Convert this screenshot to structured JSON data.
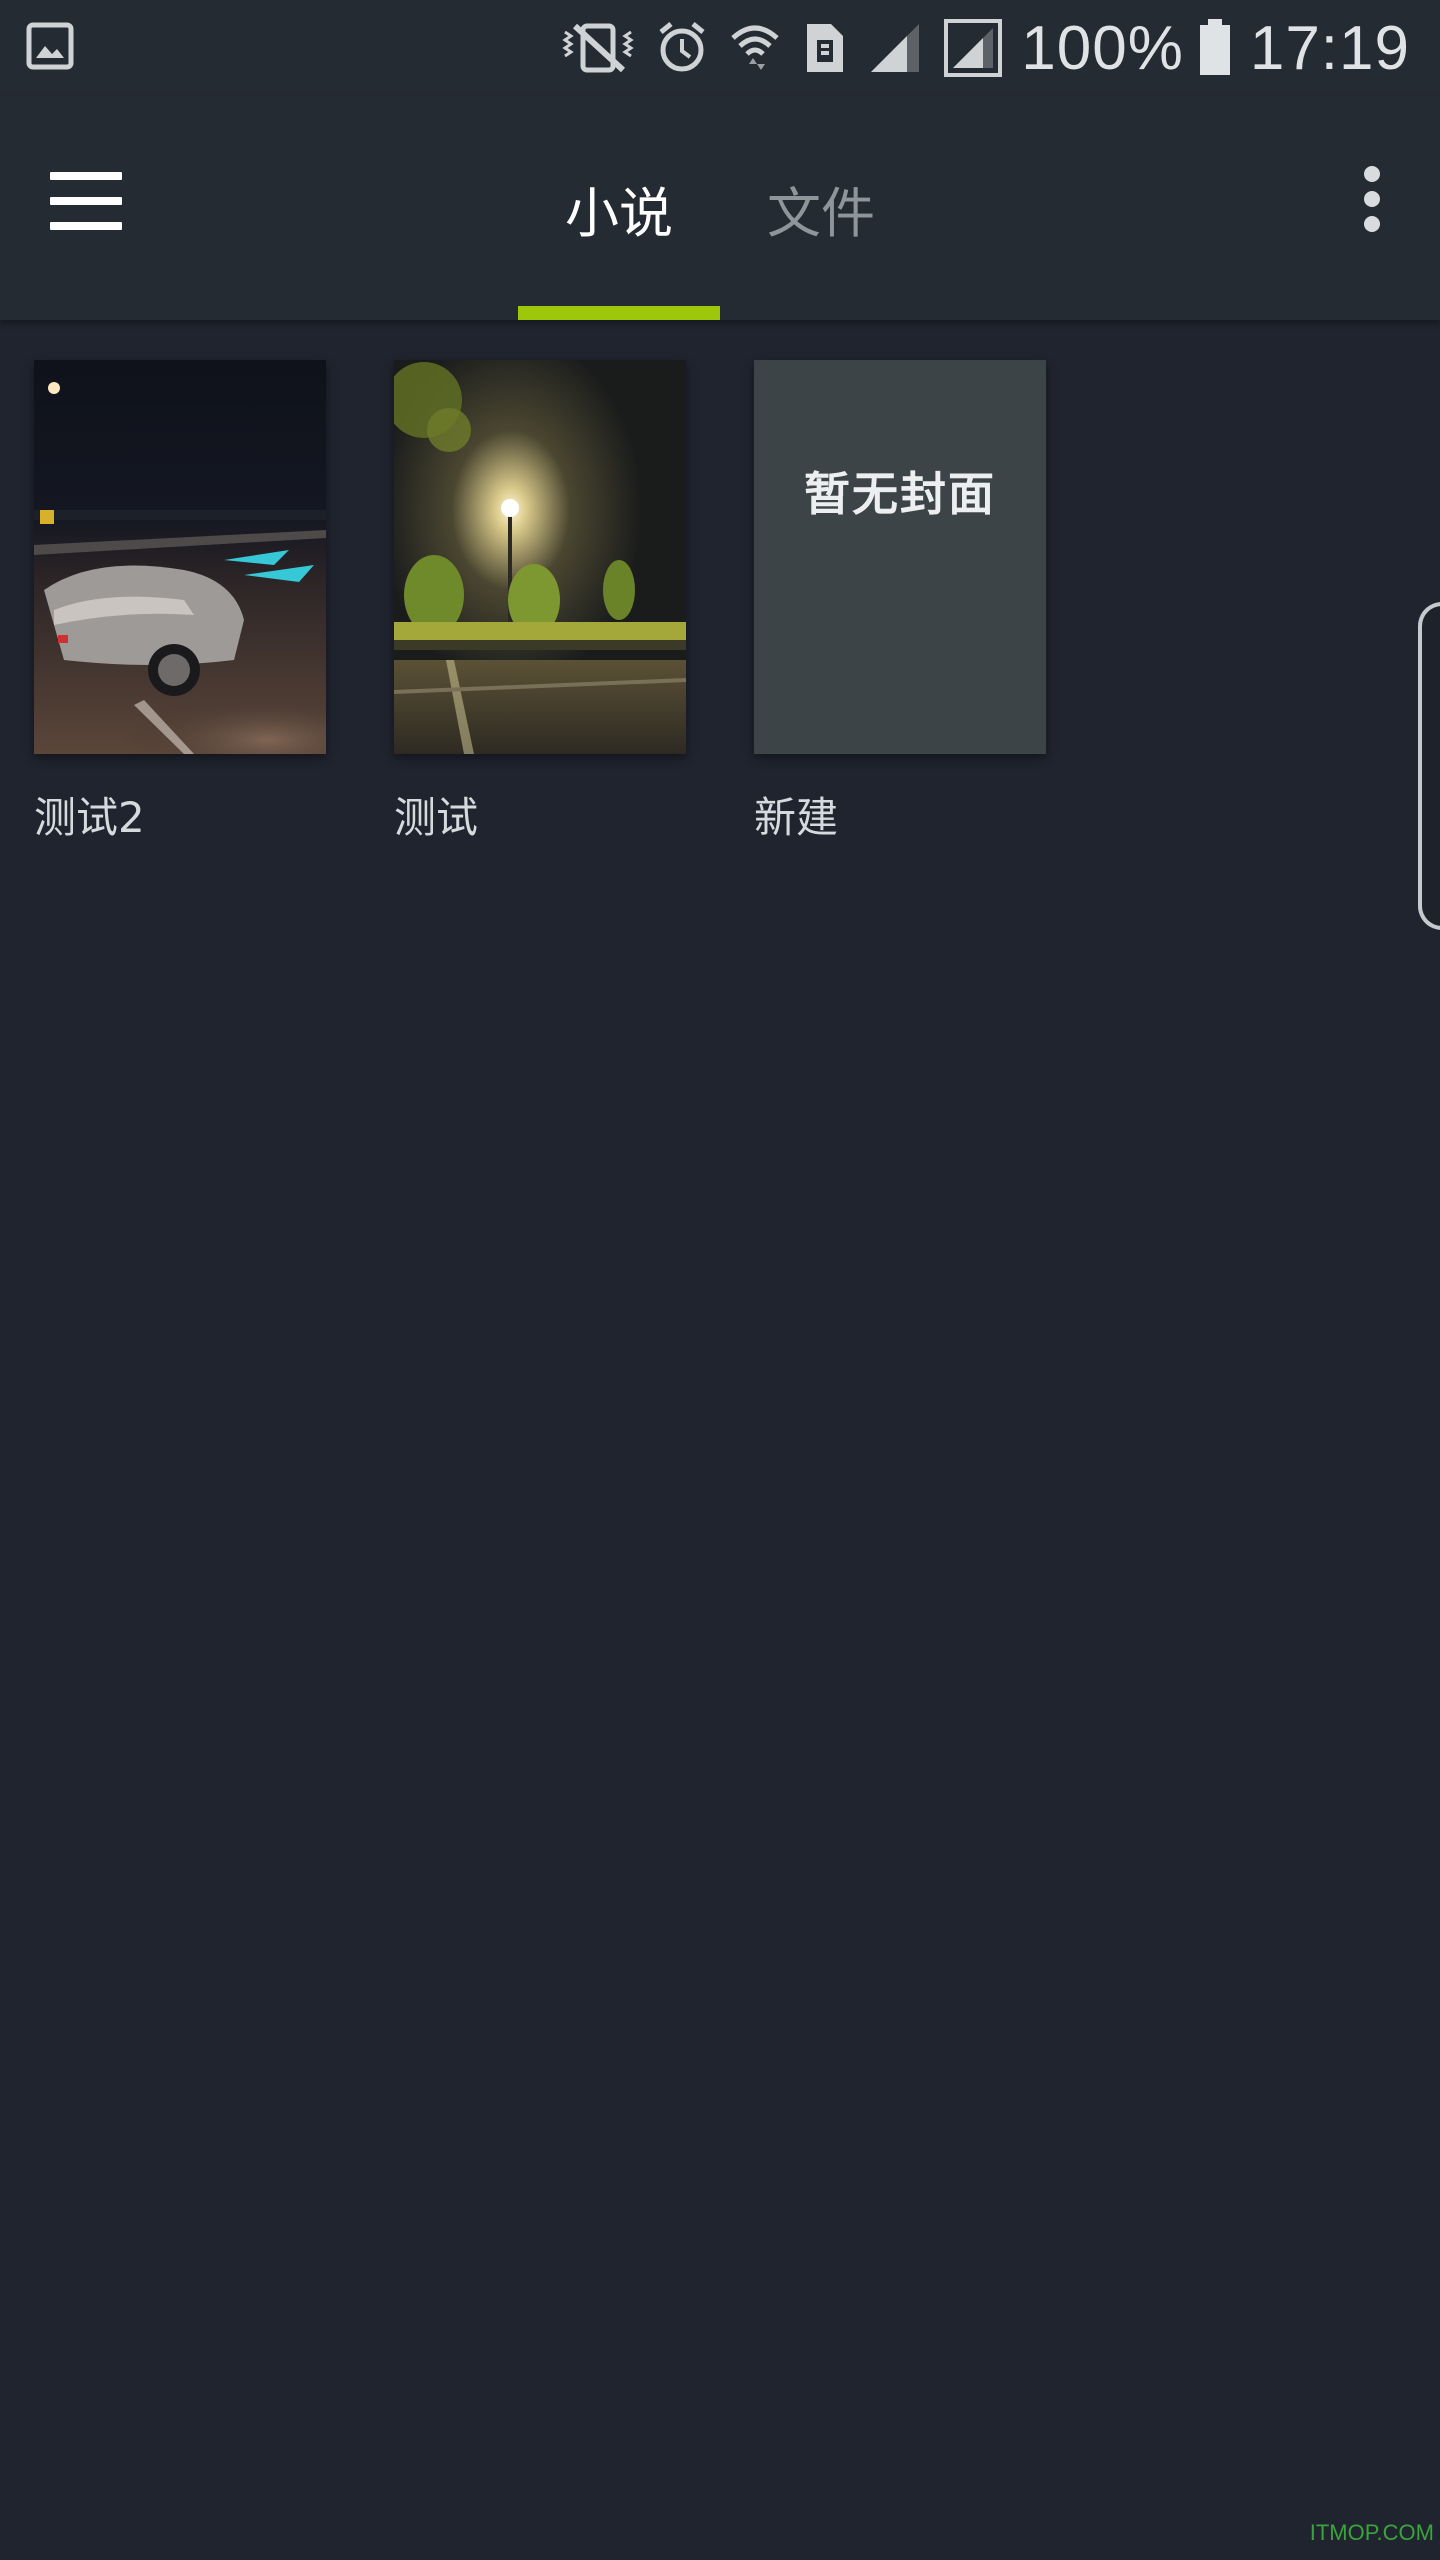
{
  "status_bar": {
    "icons": [
      "gallery-icon",
      "vibrate-mute-icon",
      "alarm-icon",
      "wifi-icon",
      "sim-card-icon",
      "signal-icon",
      "signal-icon-2",
      "battery-icon"
    ],
    "battery_text": "100%",
    "time": "17:19"
  },
  "app_bar": {
    "menu_icon": "hamburger-menu-icon",
    "more_icon": "more-vert-icon",
    "tabs": [
      {
        "label": "小说",
        "selected": true
      },
      {
        "label": "文件",
        "selected": false
      }
    ],
    "accent_color": "#9dc70b"
  },
  "books": [
    {
      "title": "测试2",
      "cover": "night-car-photo"
    },
    {
      "title": "测试",
      "cover": "night-streetlight-photo"
    },
    {
      "title": "新建",
      "cover": "none",
      "no_cover_text": "暂无封面"
    }
  ],
  "watermark": "ITMOP.COM"
}
